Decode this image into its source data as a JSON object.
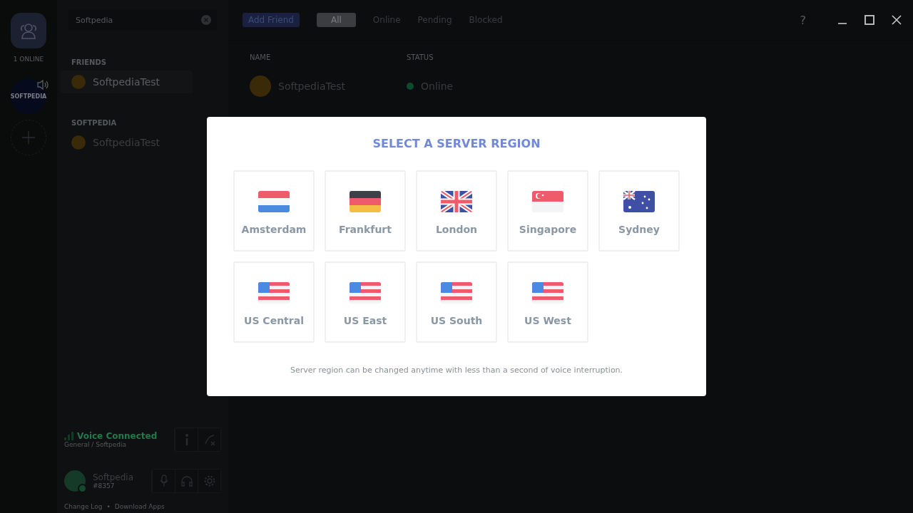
{
  "rail": {
    "online_count": "1 ONLINE",
    "server_label": "SOFTPEDIA"
  },
  "search": {
    "value": "Softpedia"
  },
  "sidebar": {
    "sections": [
      {
        "heading": "FRIENDS",
        "items": [
          {
            "name": "SoftpediaTest",
            "selected": true
          }
        ]
      },
      {
        "heading": "SOFTPEDIA",
        "items": [
          {
            "name": "SoftpediaTest",
            "selected": false
          }
        ]
      }
    ]
  },
  "voice": {
    "status": "Voice Connected",
    "channel": "General / Softpedia"
  },
  "user": {
    "name": "Softpedia",
    "tag": "#8357"
  },
  "footer": {
    "links": [
      "Change Log",
      "Download Apps"
    ],
    "separator": "•"
  },
  "toolbar": {
    "add_friend": "Add Friend",
    "tabs": [
      {
        "label": "All",
        "selected": true
      },
      {
        "label": "Online",
        "selected": false
      },
      {
        "label": "Pending",
        "selected": false
      },
      {
        "label": "Blocked",
        "selected": false
      }
    ],
    "help": "?"
  },
  "table": {
    "columns": [
      "NAME",
      "STATUS"
    ],
    "rows": [
      {
        "name": "SoftpediaTest",
        "status": "Online"
      }
    ]
  },
  "modal": {
    "title": "SELECT A SERVER REGION",
    "regions": [
      {
        "name": "Amsterdam",
        "kind": "nl"
      },
      {
        "name": "Frankfurt",
        "kind": "de"
      },
      {
        "name": "London",
        "kind": "gb"
      },
      {
        "name": "Singapore",
        "kind": "sg"
      },
      {
        "name": "Sydney",
        "kind": "au"
      },
      {
        "name": "US Central",
        "kind": "us"
      },
      {
        "name": "US East",
        "kind": "us"
      },
      {
        "name": "US South",
        "kind": "us"
      },
      {
        "name": "US West",
        "kind": "us"
      }
    ],
    "note": "Server region can be changed anytime with less than a second of voice interruption."
  }
}
